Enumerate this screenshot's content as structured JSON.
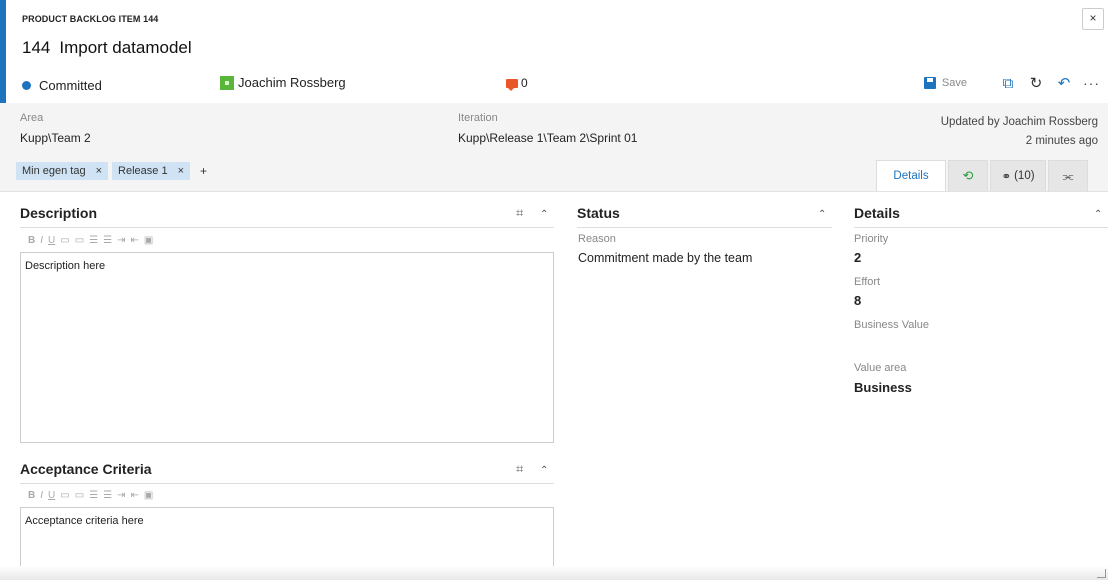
{
  "header": {
    "work_item_type": "PRODUCT BACKLOG ITEM 144",
    "id": "144",
    "title": "Import datamodel",
    "state": "Committed",
    "assigned_to": "Joachim Rossberg",
    "discussion_count": "0",
    "close_label": "×",
    "toolbar": {
      "save_label": "Save",
      "more_label": "···"
    }
  },
  "info": {
    "area_label": "Area",
    "area_value": "Kupp\\Team 2",
    "iteration_label": "Iteration",
    "iteration_value": "Kupp\\Release 1\\Team 2\\Sprint 01",
    "updated_by": "Updated by Joachim Rossberg",
    "updated_when": "2 minutes ago",
    "tags": [
      {
        "label": "Min egen tag",
        "remove": "×"
      },
      {
        "label": "Release 1",
        "remove": "×"
      }
    ],
    "add_tag": "+"
  },
  "tabs": [
    {
      "label": "Details",
      "icon": null
    },
    {
      "label": "",
      "icon": "history-icon"
    },
    {
      "label": "(10)",
      "icon": "link-icon"
    },
    {
      "label": "",
      "icon": "attachment-icon"
    }
  ],
  "description": {
    "title": "Description",
    "text": "Description here"
  },
  "acceptance": {
    "title": "Acceptance Criteria",
    "text": "Acceptance criteria here"
  },
  "status": {
    "title": "Status",
    "reason_label": "Reason",
    "reason_value": "Commitment made by the team"
  },
  "details": {
    "title": "Details",
    "priority_label": "Priority",
    "priority_value": "2",
    "effort_label": "Effort",
    "effort_value": "8",
    "business_value_label": "Business Value",
    "business_value_value": "",
    "value_area_label": "Value area",
    "value_area_value": "Business"
  },
  "colors": {
    "accent": "#1e73be",
    "tag_bg": "#cfe3f5",
    "discussion": "#e8562a",
    "avatar": "#5ab53b"
  }
}
